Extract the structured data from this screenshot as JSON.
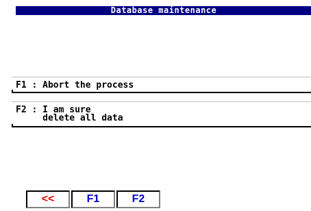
{
  "window": {
    "title": "Database maintenance"
  },
  "options": [
    {
      "lines": [
        "F1 : Abort the process"
      ]
    },
    {
      "lines": [
        "F2 : I am sure",
        "     delete all data"
      ]
    }
  ],
  "function_keys": [
    {
      "label": "<<"
    },
    {
      "label": "F1"
    },
    {
      "label": "F2"
    }
  ],
  "colors": {
    "title_bar_bg": "#000080",
    "title_text": "#ffffff",
    "back_key": "#e00000",
    "fkey_text": "#0000d0"
  }
}
